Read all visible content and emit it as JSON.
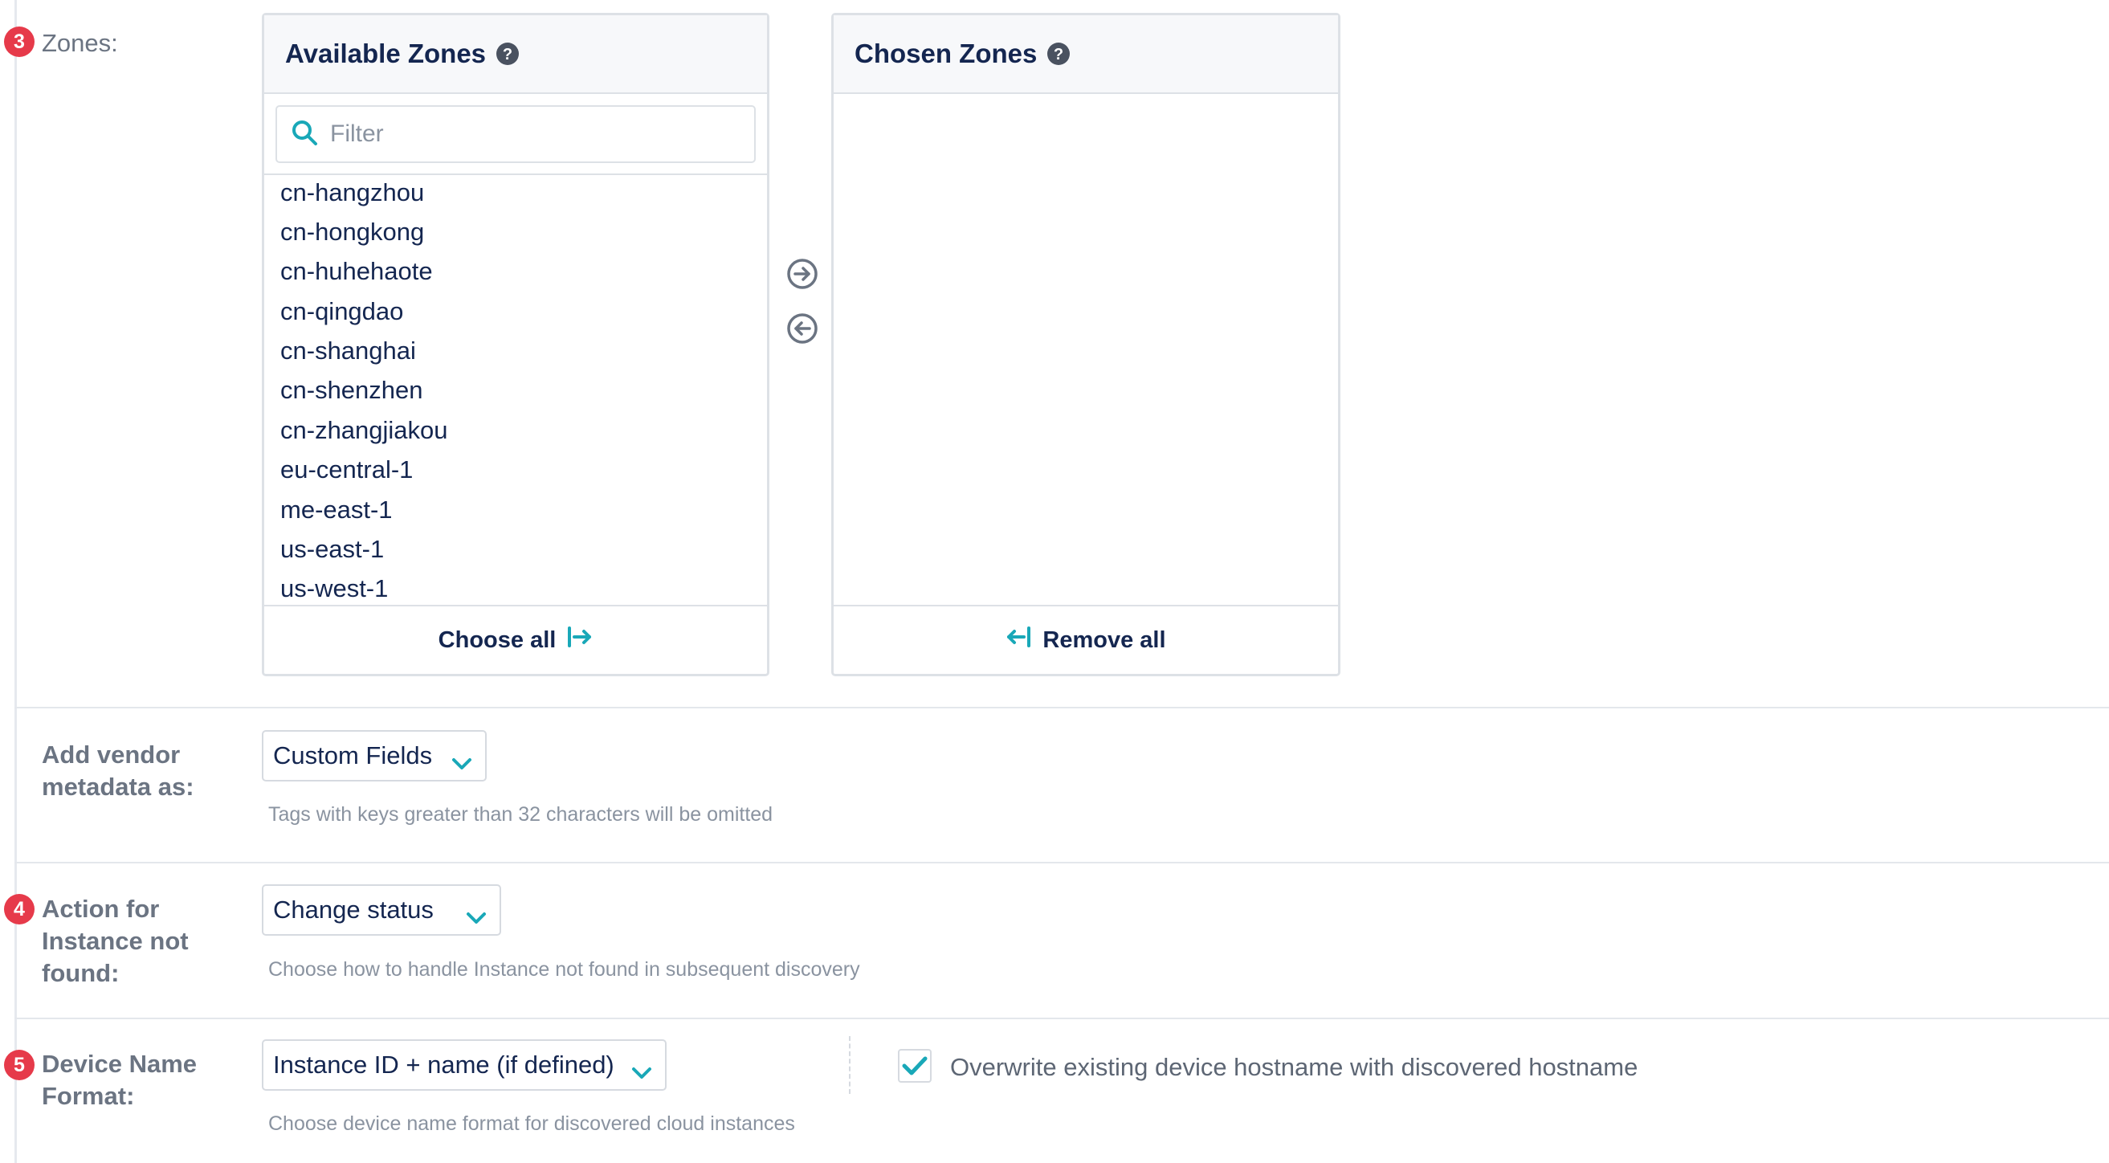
{
  "zones_field": {
    "step": "3",
    "label": "Zones:",
    "available": {
      "title": "Available Zones",
      "filter_placeholder": "Filter",
      "items": [
        "cn-hangzhou",
        "cn-hongkong",
        "cn-huhehaote",
        "cn-qingdao",
        "cn-shanghai",
        "cn-shenzhen",
        "cn-zhangjiakou",
        "eu-central-1",
        "me-east-1",
        "us-east-1",
        "us-west-1"
      ],
      "footer_label": "Choose all"
    },
    "chosen": {
      "title": "Chosen Zones",
      "footer_label": "Remove all"
    }
  },
  "vendor_metadata": {
    "label_line1": "Add vendor",
    "label_line2": "metadata as:",
    "selected": "Custom Fields",
    "helper": "Tags with keys greater than 32 characters will be omitted"
  },
  "instance_not_found": {
    "step": "4",
    "label_line1": "Action for",
    "label_line2": "Instance not",
    "label_line3": "found:",
    "selected": "Change status",
    "helper": "Choose how to handle Instance not found in subsequent discovery"
  },
  "device_name_format": {
    "step": "5",
    "label_line1": "Device Name",
    "label_line2": "Format:",
    "selected": "Instance ID + name (if defined)",
    "helper": "Choose device name format for discovered cloud instances",
    "overwrite_checkbox_label": "Overwrite existing device hostname with discovered hostname",
    "overwrite_checked": true
  },
  "colors": {
    "accent": "#19a8b8",
    "badge": "#e63a4a",
    "navy": "#142650",
    "muted": "#8a93a0"
  }
}
